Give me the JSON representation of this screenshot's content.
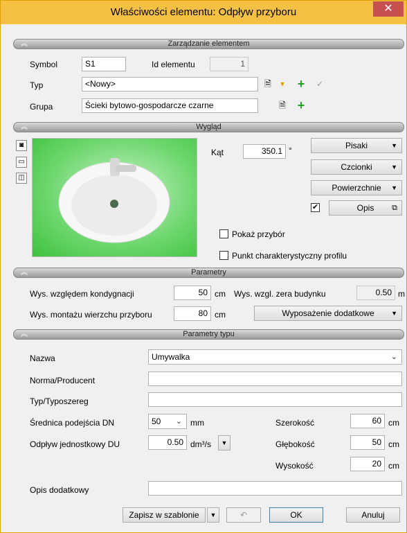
{
  "window": {
    "title": "Właściwości elementu: Odpływ przyboru",
    "close": "✕"
  },
  "sections": {
    "management": "Zarządzanie elementem",
    "appearance": "Wygląd",
    "params": "Parametry",
    "type_params": "Parametry typu"
  },
  "management": {
    "symbol_label": "Symbol",
    "symbol_value": "S1",
    "id_label": "Id elementu",
    "id_value": "1",
    "typ_label": "Typ",
    "typ_value": "<Nowy>",
    "grupa_label": "Grupa",
    "grupa_value": "Ścieki bytowo-gospodarcze czarne"
  },
  "appearance": {
    "kat_label": "Kąt",
    "kat_value": "350.1",
    "kat_unit": "°",
    "pisaki": "Pisaki",
    "czcionki": "Czcionki",
    "powierzchnie": "Powierzchnie",
    "opis": "Opis",
    "opis_checked": true,
    "pokaz_przybor": "Pokaż przybór",
    "punkt_char": "Punkt charakterystyczny profilu"
  },
  "params": {
    "wys_kond_label": "Wys. względem kondygnacji",
    "wys_kond_value": "50",
    "wys_kond_unit": "cm",
    "wys_zera_label": "Wys. wzgl. zera budynku",
    "wys_zera_value": "0.50",
    "wys_zera_unit": "m",
    "wys_montazu_label": "Wys. montażu wierzchu przyboru",
    "wys_montazu_value": "80",
    "wys_montazu_unit": "cm",
    "wyposazenie": "Wyposażenie dodatkowe"
  },
  "type_params": {
    "nazwa_label": "Nazwa",
    "nazwa_value": "Umywalka",
    "norma_label": "Norma/Producent",
    "typoszereg_label": "Typ/Typoszereg",
    "srednica_label": "Średnica podejścia DN",
    "srednica_value": "50",
    "srednica_unit": "mm",
    "odplyw_label": "Odpływ jednostkowy DU",
    "odplyw_value": "0.50",
    "odplyw_unit": "dm³/s",
    "szerokosc_label": "Szerokość",
    "szerokosc_value": "60",
    "glebokosc_label": "Głębokość",
    "glebokosc_value": "50",
    "wysokosc_label": "Wysokość",
    "wysokosc_value": "20",
    "dim_unit": "cm",
    "opis_dod_label": "Opis dodatkowy"
  },
  "footer": {
    "zapisz": "Zapisz w szablonie",
    "ok": "OK",
    "anuluj": "Anuluj"
  }
}
